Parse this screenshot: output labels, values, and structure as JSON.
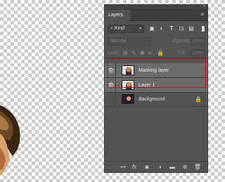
{
  "panel": {
    "tab_label": "Layers",
    "collapse_glyph": "«",
    "menu_glyph": "≡"
  },
  "filter": {
    "kind_label": "Kind",
    "icons": [
      "image-filter-icon",
      "adjustment-filter-icon",
      "type-filter-icon",
      "shape-filter-icon",
      "smart-object-filter-icon"
    ]
  },
  "blend": {
    "mode_label": "Normal",
    "opacity_label": "Opacity:",
    "opacity_value": "100%"
  },
  "lock": {
    "label": "Lock:",
    "fill_label": "Fill:",
    "fill_value": "100%"
  },
  "layers": [
    {
      "name": "Masking layer",
      "visible": true,
      "selected": true
    },
    {
      "name": "Layer 1",
      "visible": true,
      "selected": true
    },
    {
      "name": "Background",
      "visible": false,
      "selected": false,
      "locked": true
    }
  ],
  "bottom_icons": [
    "link-icon",
    "fx-icon",
    "mask-icon",
    "adjustment-icon",
    "group-icon",
    "new-layer-icon",
    "trash-icon"
  ],
  "colors": {
    "panel_bg": "#535353",
    "selected_row": "#6b6b6b",
    "highlight": "#b02020"
  }
}
